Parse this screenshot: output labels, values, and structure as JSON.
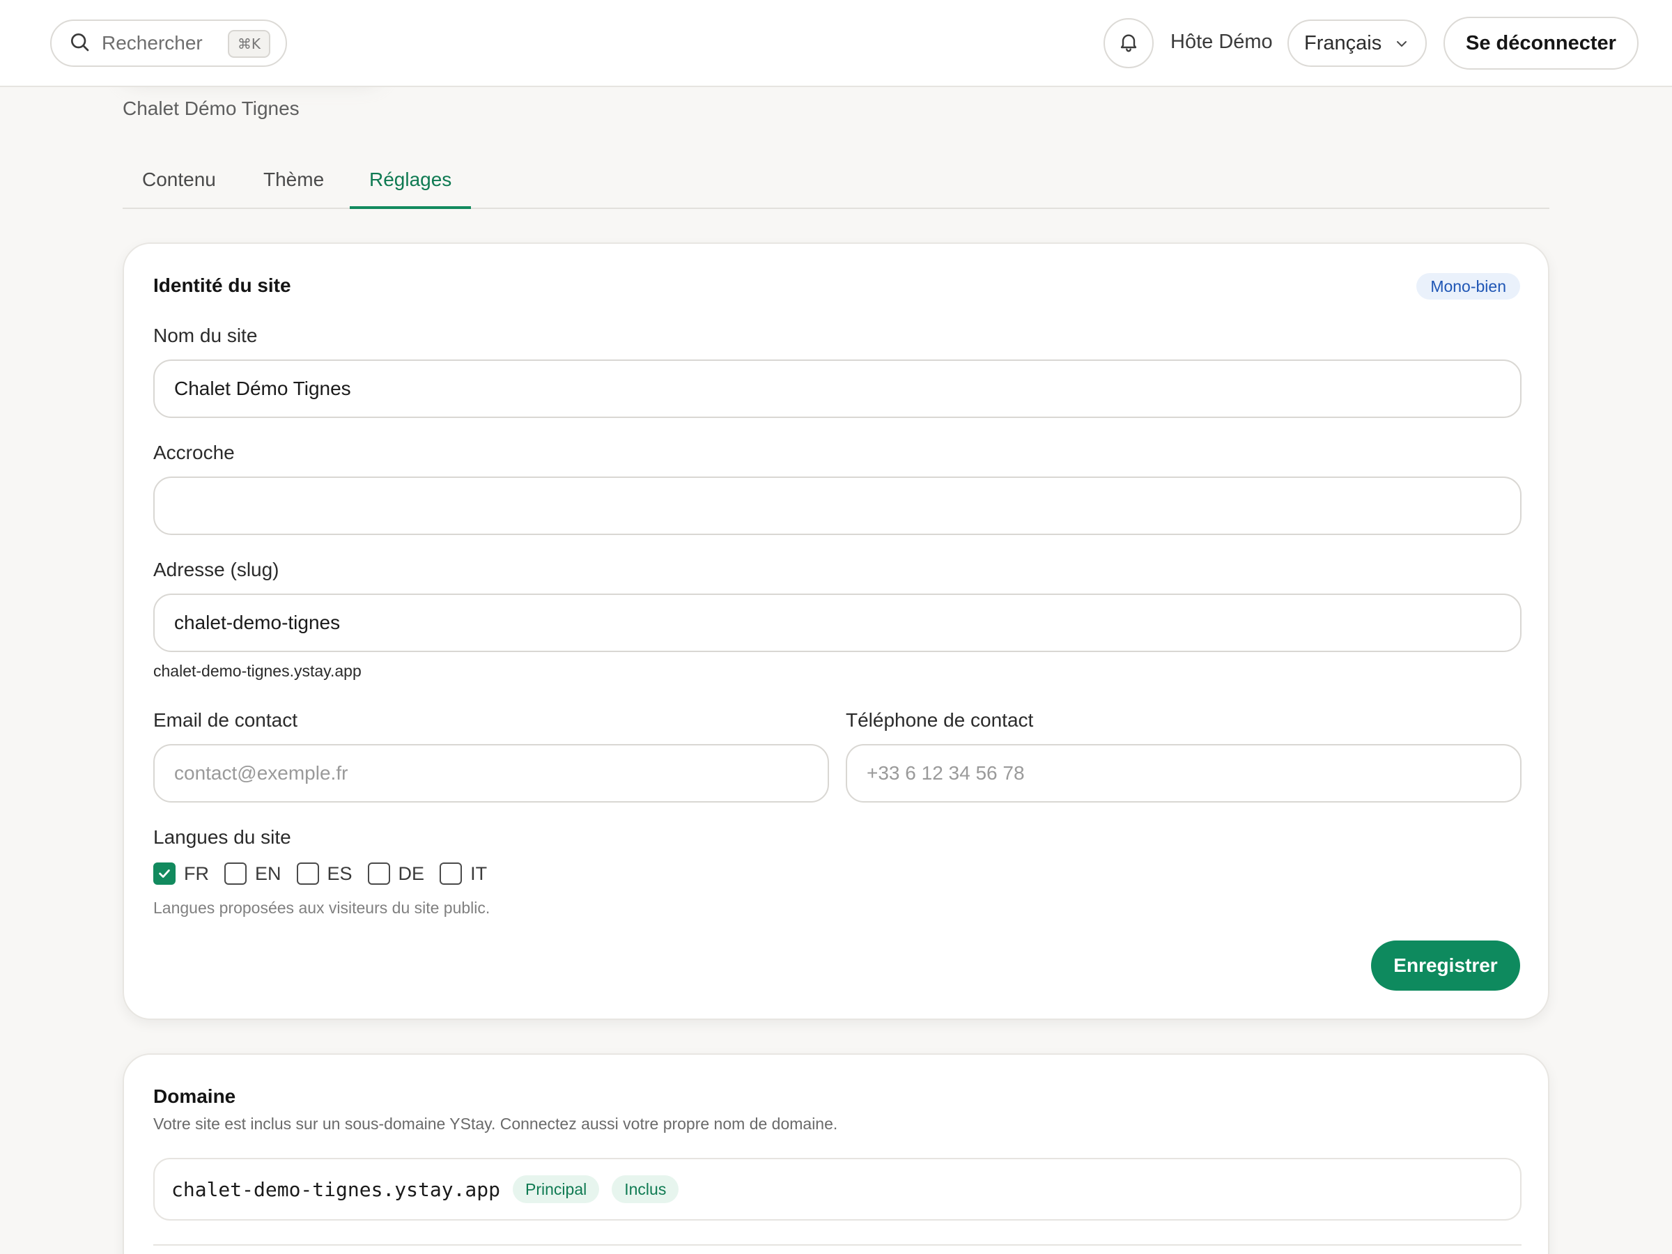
{
  "header": {
    "search_placeholder": "Rechercher",
    "search_shortcut": "⌘K",
    "user_name": "Hôte Démo",
    "language": "Français",
    "logout_label": "Se déconnecter"
  },
  "page": {
    "subtitle": "Chalet Démo Tignes",
    "tabs": [
      {
        "label": "Contenu",
        "active": false
      },
      {
        "label": "Thème",
        "active": false
      },
      {
        "label": "Réglages",
        "active": true
      }
    ]
  },
  "identity": {
    "title": "Identité du site",
    "badge": "Mono-bien",
    "site_name_label": "Nom du site",
    "site_name_value": "Chalet Démo Tignes",
    "tagline_label": "Accroche",
    "tagline_value": "",
    "slug_label": "Adresse (slug)",
    "slug_value": "chalet-demo-tignes",
    "slug_url": "chalet-demo-tignes.ystay.app",
    "email_label": "Email de contact",
    "email_placeholder": "contact@exemple.fr",
    "phone_label": "Téléphone de contact",
    "phone_placeholder": "+33 6 12 34 56 78",
    "languages_label": "Langues du site",
    "languages": [
      {
        "code": "FR",
        "checked": true
      },
      {
        "code": "EN",
        "checked": false
      },
      {
        "code": "ES",
        "checked": false
      },
      {
        "code": "DE",
        "checked": false
      },
      {
        "code": "IT",
        "checked": false
      }
    ],
    "languages_hint": "Langues proposées aux visiteurs du site public.",
    "save_label": "Enregistrer"
  },
  "domain": {
    "title": "Domaine",
    "description": "Votre site est inclus sur un sous-domaine YStay. Connectez aussi votre propre nom de domaine.",
    "entries": [
      {
        "name": "chalet-demo-tignes.ystay.app",
        "tags": [
          "Principal",
          "Inclus"
        ]
      }
    ]
  },
  "colors": {
    "accent": "#0e8a5e",
    "badge_blue_bg": "#eaf1fb",
    "badge_blue_text": "#1f56b5",
    "page_bg": "#f8f7f5"
  }
}
